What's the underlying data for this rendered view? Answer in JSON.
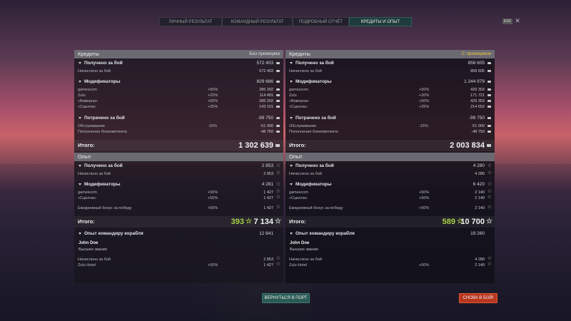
{
  "tabs": [
    {
      "label": "ЛИЧНЫЙ РЕЗУЛЬТАТ"
    },
    {
      "label": "КОМАНДНЫЙ РЕЗУЛЬТАТ"
    },
    {
      "label": "ПОДРОБНЫЙ ОТЧЁТ"
    },
    {
      "label": "КРЕДИТЫ И ОПЫТ"
    }
  ],
  "esc": {
    "badge": "ESC",
    "close": "✕"
  },
  "left": {
    "credits_header": "Кредиты",
    "credits_mode": "Без премиума",
    "received_label": "Получено за бой",
    "received_value": "572 403",
    "accrued_label": "Начислено за бой",
    "accrued_value": "572 403",
    "mods_label": "Модификаторы",
    "mods_value": "829 686",
    "mods": [
      {
        "name": "gamescom",
        "pct": "+50%",
        "value": "286 202"
      },
      {
        "name": "Zulu",
        "pct": "+20%",
        "value": "114 481"
      },
      {
        "name": "«Виверна»",
        "pct": "+50%",
        "value": "286 202"
      },
      {
        "name": "«Сцилла»",
        "pct": "+25%",
        "value": "143 101"
      }
    ],
    "spent_label": "Потрачено за бой",
    "spent_value": "-99 750",
    "spent": [
      {
        "name": "Обслуживание",
        "pct": "-15%",
        "value": "-51 000"
      },
      {
        "name": "Пополнение боекомплекта",
        "pct": "",
        "value": "-48 750"
      }
    ],
    "total_label": "Итого:",
    "total_value": "1 302 639",
    "xp_header": "Опыт",
    "xp_received_label": "Получено за бой",
    "xp_received_value": "2 853",
    "xp_accrued_label": "Начислено за бой",
    "xp_accrued_value": "2 853",
    "xp_mods_label": "Модификаторы",
    "xp_mods_value": "4 281",
    "xp_mods": [
      {
        "name": "gamescom",
        "pct": "+50%",
        "value": "1 427"
      },
      {
        "name": "«Сцилла»",
        "pct": "+50%",
        "value": "1 427"
      }
    ],
    "daily_label": "Ежедневный бонус за победу",
    "daily_pct": "+50%",
    "daily_value": "1 427",
    "xp_total_label": "Итого:",
    "xp_total_free": "393",
    "xp_total_value": "7 134",
    "cmdr_label": "Опыт командиру корабля",
    "cmdr_value": "12 841",
    "cmdr_name": "John Doe",
    "cmdr_title": "Высшее звание",
    "cmdr_rows": [
      {
        "name": "Начислено за бой",
        "pct": "",
        "value": "2 853"
      },
      {
        "name": "Zulu Hotel",
        "pct": "+50%",
        "value": "1 427"
      }
    ]
  },
  "right": {
    "credits_header": "Кредиты",
    "credits_mode": "С премиумом",
    "received_label": "Получено за бой",
    "received_value": "858 605",
    "accrued_label": "Начислено за бой",
    "accrued_value": "858 605",
    "mods_label": "Модификаторы",
    "mods_value": "1 244 979",
    "mods": [
      {
        "name": "gamescom",
        "pct": "+50%",
        "value": "429 303"
      },
      {
        "name": "Zulu",
        "pct": "+20%",
        "value": "171 721"
      },
      {
        "name": "«Виверна»",
        "pct": "+50%",
        "value": "429 303"
      },
      {
        "name": "«Сцилла»",
        "pct": "+25%",
        "value": "214 652"
      }
    ],
    "spent_label": "Потрачено за бой",
    "spent_value": "-99 750",
    "spent": [
      {
        "name": "Обслуживание",
        "pct": "-15%",
        "value": "-51 000"
      },
      {
        "name": "Пополнение боекомплекта",
        "pct": "",
        "value": "-48 750"
      }
    ],
    "total_label": "Итого:",
    "total_value": "2 003 834",
    "xp_header": "Опыт",
    "xp_received_label": "Получено за бой",
    "xp_received_value": "4 280",
    "xp_accrued_label": "Начислено за бой",
    "xp_accrued_value": "4 280",
    "xp_mods_label": "Модификаторы",
    "xp_mods_value": "6 420",
    "xp_mods": [
      {
        "name": "gamescom",
        "pct": "+50%",
        "value": "2 140"
      },
      {
        "name": "«Сцилла»",
        "pct": "+50%",
        "value": "2 140"
      }
    ],
    "daily_label": "Ежедневный бонус за победу",
    "daily_pct": "+50%",
    "daily_value": "2 140",
    "xp_total_label": "Итого:",
    "xp_total_free": "589",
    "xp_total_value": "10 700",
    "cmdr_label": "Опыт командиру корабля",
    "cmdr_value": "19 260",
    "cmdr_name": "John Doe",
    "cmdr_title": "Высшее звание",
    "cmdr_rows": [
      {
        "name": "Начислено за бой",
        "pct": "",
        "value": "4 280"
      },
      {
        "name": "Zulu Hotel",
        "pct": "+50%",
        "value": "2 140"
      }
    ]
  },
  "buttons": {
    "port": "ВЕРНУТЬСЯ В ПОРТ",
    "battle": "СНОВА В БОЙ!"
  }
}
